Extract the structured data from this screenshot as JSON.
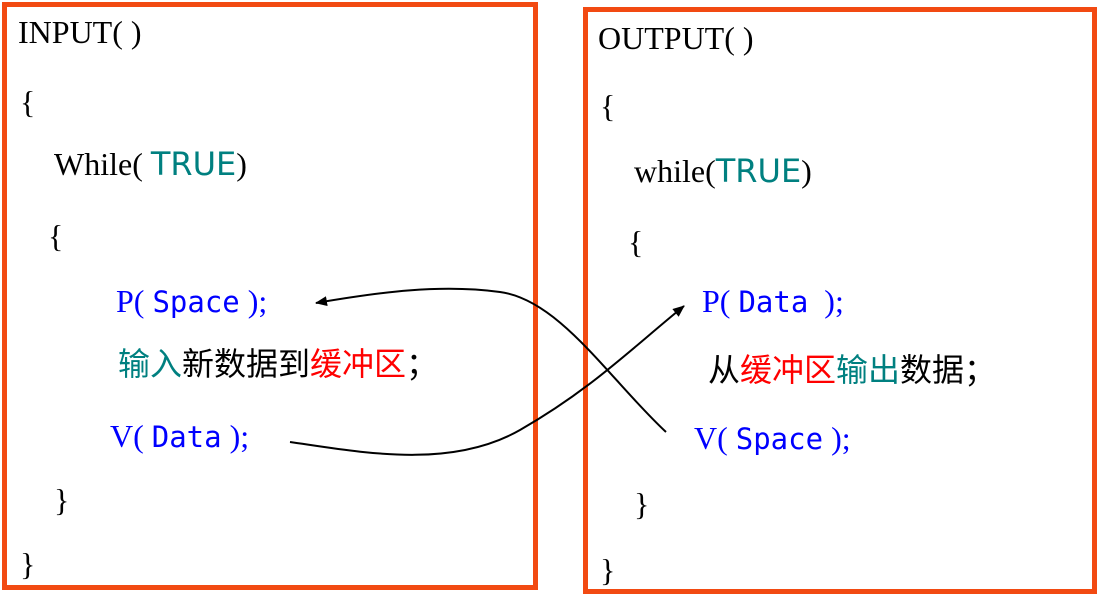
{
  "input_block": {
    "header": "INPUT( )",
    "open_brace": "{",
    "while_prefix": "While( ",
    "while_cond": "TRUE",
    "while_suffix": ")",
    "inner_open_brace": "{",
    "p_prefix": "P( ",
    "p_arg": "Space",
    "p_suffix": " );",
    "action_part1": "输入",
    "action_part2": "新数据到",
    "action_part3": "缓冲区",
    "action_part4": "；",
    "v_prefix": "V( ",
    "v_arg": "Data",
    "v_suffix": " );",
    "inner_close_brace": "}",
    "close_brace": "}"
  },
  "output_block": {
    "header": "OUTPUT( )",
    "open_brace": "{",
    "while_prefix": "while(",
    "while_cond": "TRUE",
    "while_suffix": ")",
    "inner_open_brace": "{",
    "p_prefix": "P( ",
    "p_arg": "Data",
    "p_suffix": "  );",
    "action_part1": "从",
    "action_part2": "缓冲区",
    "action_part3": "输出",
    "action_part4": "数据；",
    "v_prefix": "V( ",
    "v_arg": "Space",
    "v_suffix": " );",
    "inner_close_brace": "}",
    "close_brace": "}"
  },
  "colors": {
    "border": "#f24a12",
    "keyword_blue": "#0000ff",
    "teal": "#008080",
    "red": "#ff0000"
  }
}
